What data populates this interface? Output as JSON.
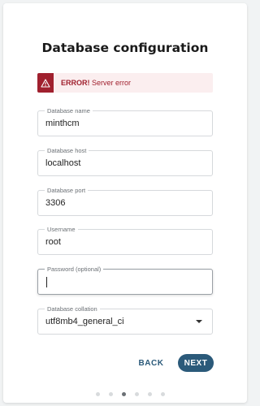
{
  "page": {
    "title": "Database configuration"
  },
  "alert": {
    "prefix": "ERROR!",
    "message": "Server error",
    "icon": "warning-triangle-icon",
    "color": "#a0202e"
  },
  "fields": {
    "db_name": {
      "label": "Database name",
      "value": "minthcm"
    },
    "db_host": {
      "label": "Database host",
      "value": "localhost"
    },
    "db_port": {
      "label": "Database port",
      "value": "3306"
    },
    "username": {
      "label": "Username",
      "value": "root"
    },
    "password": {
      "label": "Password (optional)",
      "value": ""
    },
    "collation": {
      "label": "Database collation",
      "value": "utf8mb4_general_ci"
    }
  },
  "actions": {
    "back_label": "BACK",
    "next_label": "NEXT",
    "accent": "#2b5a7a"
  },
  "stepper": {
    "steps": 6,
    "active": 3
  }
}
